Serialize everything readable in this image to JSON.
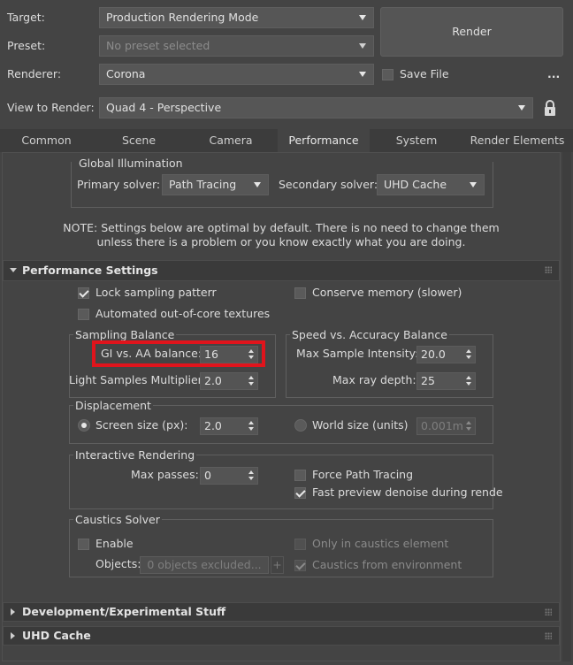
{
  "header": {
    "target_label": "Target:",
    "target_value": "Production Rendering Mode",
    "preset_label": "Preset:",
    "preset_value": "No preset selected",
    "renderer_label": "Renderer:",
    "renderer_value": "Corona",
    "view_label": "View to Render:",
    "view_value": "Quad 4 - Perspective",
    "render_button": "Render",
    "save_file_label": "Save File",
    "save_file_checked": false,
    "more_button": "..."
  },
  "tabs": [
    {
      "label": "Common",
      "active": false
    },
    {
      "label": "Scene",
      "active": false
    },
    {
      "label": "Camera",
      "active": false
    },
    {
      "label": "Performance",
      "active": true
    },
    {
      "label": "System",
      "active": false
    },
    {
      "label": "Render Elements",
      "active": false
    }
  ],
  "global_illumination": {
    "title": "Global Illumination",
    "primary_label": "Primary solver:",
    "primary_value": "Path Tracing",
    "secondary_label": "Secondary solver:",
    "secondary_value": "UHD Cache",
    "note_line1": "NOTE: Settings below are optimal by default. There is no need to change them",
    "note_line2": "unless there is a problem or you know exactly what you are doing."
  },
  "performance": {
    "title": "Performance Settings",
    "lock_sampling": "Lock sampling patterr",
    "lock_sampling_checked": true,
    "conserve_memory": "Conserve memory (slower)",
    "conserve_memory_checked": false,
    "out_of_core": "Automated out-of-core textures",
    "out_of_core_checked": false,
    "sampling_balance": {
      "title": "Sampling Balance",
      "gi_aa_label": "GI vs. AA balance:",
      "gi_aa_value": "16",
      "light_samples_label": "Light Samples Multiplier:",
      "light_samples_value": "2.0"
    },
    "speed_accuracy": {
      "title": "Speed vs. Accuracy Balance",
      "max_sample_label": "Max Sample Intensity:",
      "max_sample_value": "20.0",
      "max_ray_label": "Max ray depth:",
      "max_ray_value": "25"
    },
    "displacement": {
      "title": "Displacement",
      "screen_size_label": "Screen size (px):",
      "screen_size_value": "2.0",
      "world_size_label": "World size (units)",
      "world_size_value": "0.001m",
      "selected": "screen"
    },
    "interactive": {
      "title": "Interactive Rendering",
      "max_passes_label": "Max passes:",
      "max_passes_value": "0",
      "force_path_tracing": "Force Path Tracing",
      "force_path_tracing_checked": false,
      "fast_preview": "Fast preview denoise during rende",
      "fast_preview_checked": true
    },
    "caustics": {
      "title": "Caustics Solver",
      "enable_label": "Enable",
      "enable_checked": false,
      "objects_label": "Objects:",
      "objects_value": "0 objects excluded...",
      "add_button": "+",
      "only_in_caustics": "Only in caustics element",
      "caustics_from_env": "Caustics from environment",
      "caustics_from_env_checked": true
    }
  },
  "rollouts": [
    {
      "title": "Development/Experimental Stuff"
    },
    {
      "title": "UHD Cache"
    }
  ],
  "colors": {
    "background": "#444444",
    "highlight": "#e0141c"
  }
}
